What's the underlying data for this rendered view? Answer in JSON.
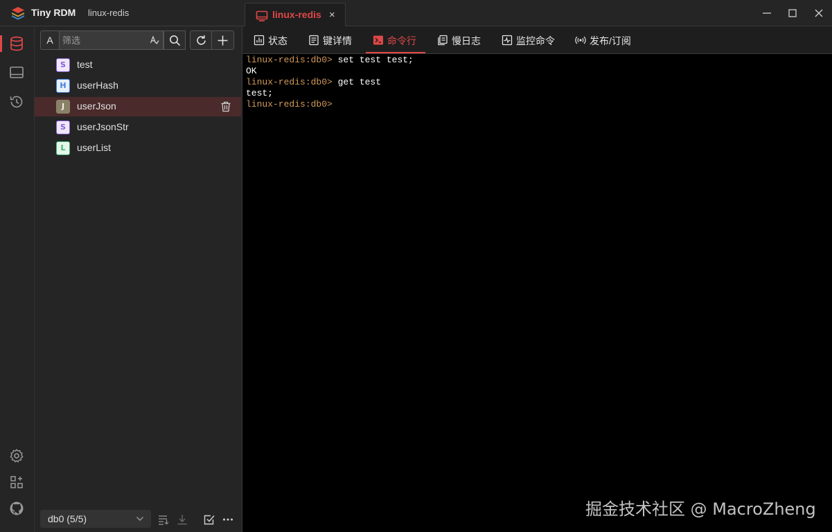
{
  "window": {
    "app_name": "Tiny RDM",
    "connection_name": "linux-redis",
    "controls": [
      "minimize-icon",
      "maximize-icon",
      "close-icon"
    ]
  },
  "connection_tab": {
    "label": "linux-redis",
    "close_glyph": "×"
  },
  "icon_bar": {
    "top": [
      "database-icon",
      "server-icon",
      "history-icon"
    ],
    "bottom": [
      "settings-icon",
      "apps-icon",
      "github-icon"
    ],
    "active_color": "#e04848"
  },
  "sidebar": {
    "filter_type_label": "A",
    "filter_placeholder": "筛选",
    "toolbar_icons": [
      "search-icon",
      "refresh-icon",
      "add-icon"
    ],
    "keys": [
      {
        "type": "S",
        "name": "test"
      },
      {
        "type": "H",
        "name": "userHash"
      },
      {
        "type": "J",
        "name": "userJson",
        "selected": true
      },
      {
        "type": "S",
        "name": "userJsonStr"
      },
      {
        "type": "L",
        "name": "userList"
      }
    ],
    "type_colors": {
      "S": "#8a5cd6",
      "H": "#3f7fe0",
      "J": "#8a8268",
      "L": "#3fb56c"
    },
    "db_select": "db0 (5/5)",
    "footer_icons": [
      "filter-list-icon",
      "download-icon",
      "check-square-icon",
      "more-icon"
    ]
  },
  "tabs": [
    {
      "label": "状态",
      "icon": "status-icon"
    },
    {
      "label": "键详情",
      "icon": "key-detail-icon"
    },
    {
      "label": "命令行",
      "icon": "terminal-icon",
      "active": true
    },
    {
      "label": "慢日志",
      "icon": "slow-log-icon"
    },
    {
      "label": "监控命令",
      "icon": "monitor-icon"
    },
    {
      "label": "发布/订阅",
      "icon": "broadcast-icon"
    }
  ],
  "terminal": {
    "lines": [
      {
        "prompt": "linux-redis:db0> ",
        "text": "set test test;"
      },
      {
        "prompt": "",
        "text": "OK"
      },
      {
        "prompt": "linux-redis:db0> ",
        "text": "get test"
      },
      {
        "prompt": "",
        "text": "test;"
      },
      {
        "prompt": "linux-redis:db0> ",
        "text": ""
      }
    ]
  },
  "watermark": "掘金技术社区 @ MacroZheng"
}
